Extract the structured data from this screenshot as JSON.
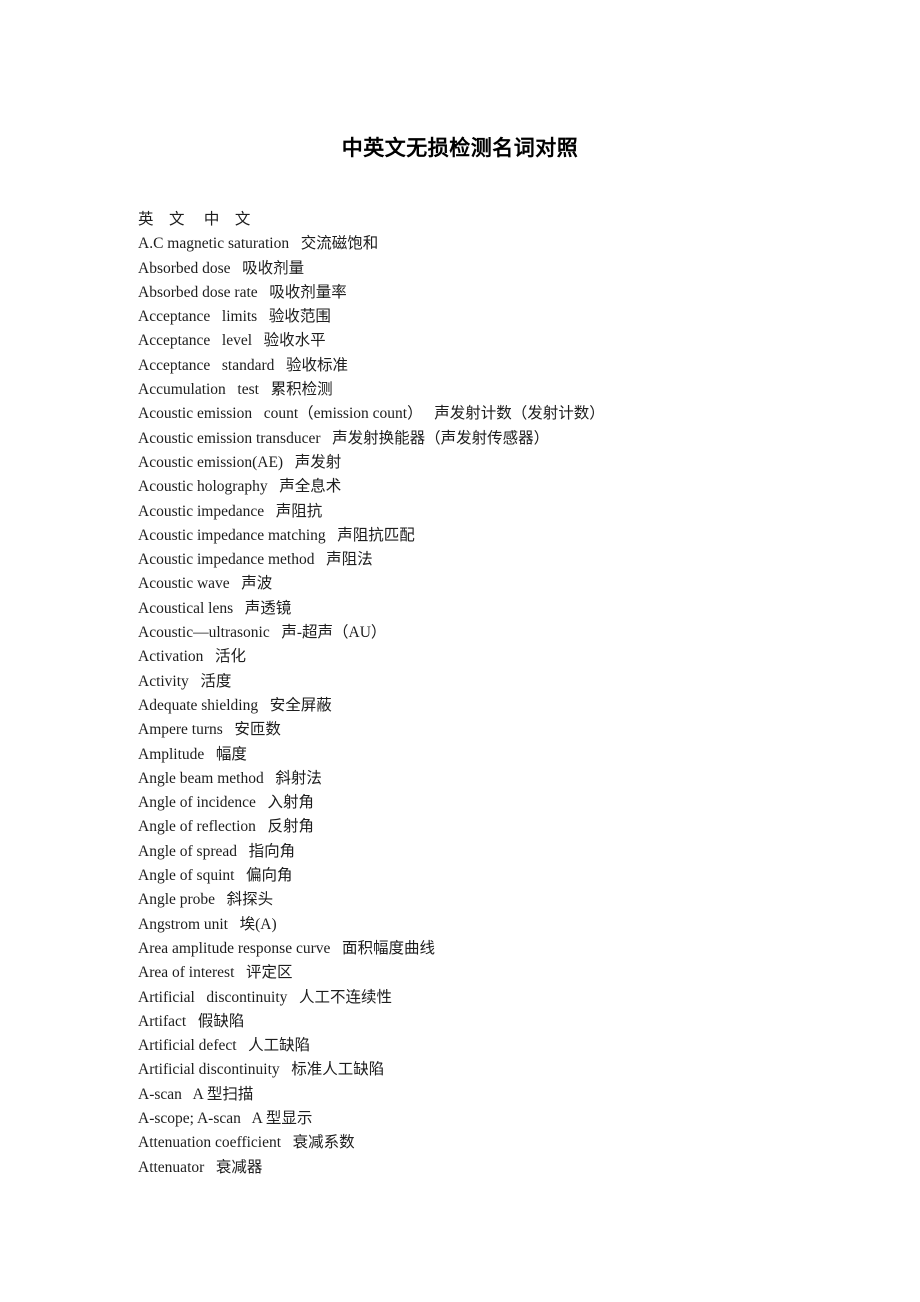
{
  "document": {
    "title": "中英文无损检测名词对照",
    "columns_header": "英    文     中    文",
    "entries": [
      {
        "english": "A.C magnetic saturation",
        "chinese": "交流磁饱和",
        "line": "A.C magnetic saturation   交流磁饱和"
      },
      {
        "english": "Absorbed dose",
        "chinese": "吸收剂量",
        "line": "Absorbed dose   吸收剂量"
      },
      {
        "english": "Absorbed dose rate",
        "chinese": "吸收剂量率",
        "line": "Absorbed dose rate   吸收剂量率"
      },
      {
        "english": "Acceptance   limits",
        "chinese": "验收范围",
        "line": "Acceptance   limits   验收范围"
      },
      {
        "english": "Acceptance   level",
        "chinese": "验收水平",
        "line": "Acceptance   level   验收水平"
      },
      {
        "english": "Acceptance   standard",
        "chinese": "验收标准",
        "line": "Acceptance   standard   验收标准"
      },
      {
        "english": "Accumulation   test",
        "chinese": "累积检测",
        "line": "Accumulation   test   累积检测"
      },
      {
        "english": "Acoustic emission   count（emission count）",
        "chinese": "声发射计数（发射计数）",
        "line": "Acoustic emission   count（emission count）   声发射计数（发射计数）"
      },
      {
        "english": "Acoustic emission transducer",
        "chinese": "声发射换能器（声发射传感器）",
        "line": "Acoustic emission transducer   声发射换能器（声发射传感器）"
      },
      {
        "english": "Acoustic emission(AE)",
        "chinese": "声发射",
        "line": "Acoustic emission(AE)   声发射"
      },
      {
        "english": "Acoustic holography",
        "chinese": "声全息术",
        "line": "Acoustic holography   声全息术"
      },
      {
        "english": "Acoustic impedance",
        "chinese": "声阻抗",
        "line": "Acoustic impedance   声阻抗"
      },
      {
        "english": "Acoustic impedance matching",
        "chinese": "声阻抗匹配",
        "line": "Acoustic impedance matching   声阻抗匹配"
      },
      {
        "english": "Acoustic impedance method",
        "chinese": "声阻法",
        "line": "Acoustic impedance method   声阻法"
      },
      {
        "english": "Acoustic wave",
        "chinese": "声波",
        "line": "Acoustic wave   声波"
      },
      {
        "english": "Acoustical lens",
        "chinese": "声透镜",
        "line": "Acoustical lens   声透镜"
      },
      {
        "english": "Acoustic—ultrasonic",
        "chinese": "声-超声（AU）",
        "line": "Acoustic—ultrasonic   声-超声（AU）"
      },
      {
        "english": "Activation",
        "chinese": "活化",
        "line": "Activation   活化"
      },
      {
        "english": "Activity",
        "chinese": "活度",
        "line": "Activity   活度"
      },
      {
        "english": "Adequate shielding",
        "chinese": "安全屏蔽",
        "line": "Adequate shielding   安全屏蔽"
      },
      {
        "english": "Ampere turns",
        "chinese": "安匝数",
        "line": "Ampere turns   安匝数"
      },
      {
        "english": "Amplitude",
        "chinese": "幅度",
        "line": "Amplitude   幅度"
      },
      {
        "english": "Angle beam method",
        "chinese": "斜射法",
        "line": "Angle beam method   斜射法"
      },
      {
        "english": "Angle of incidence",
        "chinese": "入射角",
        "line": "Angle of incidence   入射角"
      },
      {
        "english": "Angle of reflection",
        "chinese": "反射角",
        "line": "Angle of reflection   反射角"
      },
      {
        "english": "Angle of spread",
        "chinese": "指向角",
        "line": "Angle of spread   指向角"
      },
      {
        "english": "Angle of squint",
        "chinese": "偏向角",
        "line": "Angle of squint   偏向角"
      },
      {
        "english": "Angle probe",
        "chinese": "斜探头",
        "line": "Angle probe   斜探头"
      },
      {
        "english": "Angstrom unit",
        "chinese": "埃(A)",
        "line": "Angstrom unit   埃(A)"
      },
      {
        "english": "Area amplitude response curve",
        "chinese": "面积幅度曲线",
        "line": "Area amplitude response curve   面积幅度曲线"
      },
      {
        "english": "Area of interest",
        "chinese": "评定区",
        "line": "Area of interest   评定区"
      },
      {
        "english": "Artificial   discontinuity",
        "chinese": "人工不连续性",
        "line": "Artificial   discontinuity   人工不连续性"
      },
      {
        "english": "Artifact",
        "chinese": "假缺陷",
        "line": "Artifact   假缺陷"
      },
      {
        "english": "Artificial defect",
        "chinese": "人工缺陷",
        "line": "Artificial defect   人工缺陷"
      },
      {
        "english": "Artificial discontinuity",
        "chinese": "标准人工缺陷",
        "line": "Artificial discontinuity   标准人工缺陷"
      },
      {
        "english": "A-scan",
        "chinese": "A 型扫描",
        "line": "A-scan   A 型扫描"
      },
      {
        "english": "A-scope; A-scan",
        "chinese": "A 型显示",
        "line": "A-scope; A-scan   A 型显示"
      },
      {
        "english": "Attenuation coefficient",
        "chinese": "衰减系数",
        "line": "Attenuation coefficient   衰减系数"
      },
      {
        "english": "Attenuator",
        "chinese": "衰减器",
        "line": "Attenuator   衰减器"
      }
    ]
  }
}
